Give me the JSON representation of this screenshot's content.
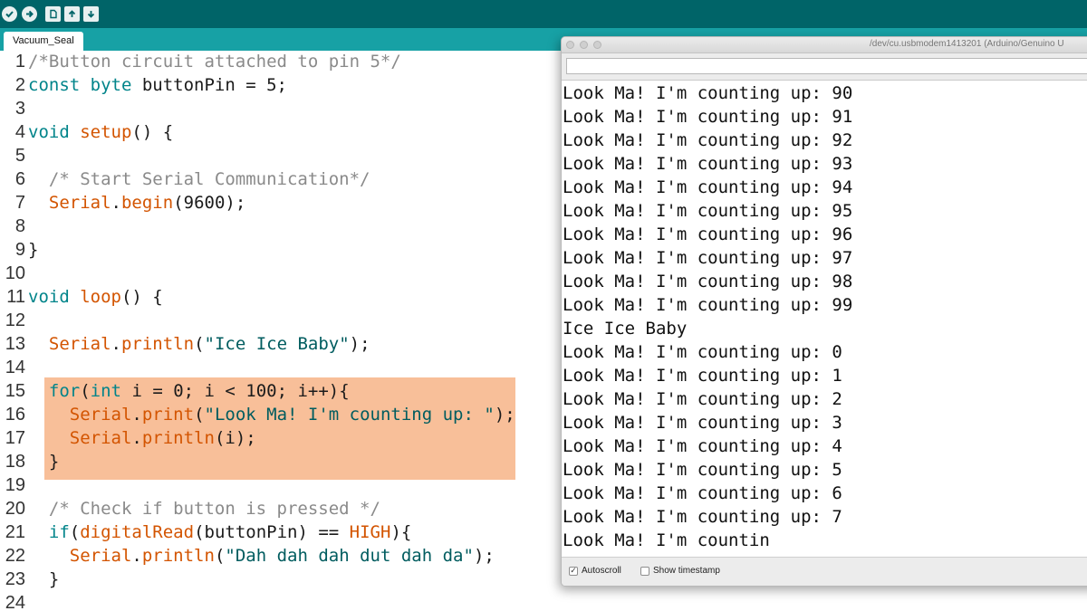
{
  "editor": {
    "tab_label": "Vacuum_Seal",
    "lines": [
      {
        "n": "1",
        "parts": [
          {
            "t": "/*Button circuit attached to pin 5*/",
            "c": "comment"
          }
        ]
      },
      {
        "n": "2",
        "parts": [
          {
            "t": "const byte ",
            "c": "kw"
          },
          {
            "t": "buttonPin = 5;",
            "c": ""
          }
        ]
      },
      {
        "n": "3",
        "parts": []
      },
      {
        "n": "4",
        "parts": [
          {
            "t": "void ",
            "c": "kw"
          },
          {
            "t": "setup",
            "c": "fn"
          },
          {
            "t": "() {",
            "c": ""
          }
        ]
      },
      {
        "n": "5",
        "parts": []
      },
      {
        "n": "6",
        "parts": [
          {
            "t": "  /* Start Serial Communication*/",
            "c": "comment"
          }
        ]
      },
      {
        "n": "7",
        "parts": [
          {
            "t": "  ",
            "c": ""
          },
          {
            "t": "Serial",
            "c": "fn"
          },
          {
            "t": ".",
            "c": ""
          },
          {
            "t": "begin",
            "c": "fn"
          },
          {
            "t": "(9600);",
            "c": ""
          }
        ]
      },
      {
        "n": "8",
        "parts": []
      },
      {
        "n": "9",
        "parts": [
          {
            "t": "}",
            "c": ""
          }
        ]
      },
      {
        "n": "10",
        "parts": []
      },
      {
        "n": "11",
        "parts": [
          {
            "t": "void ",
            "c": "kw"
          },
          {
            "t": "loop",
            "c": "fn"
          },
          {
            "t": "() {",
            "c": ""
          }
        ]
      },
      {
        "n": "12",
        "parts": []
      },
      {
        "n": "13",
        "parts": [
          {
            "t": "  ",
            "c": ""
          },
          {
            "t": "Serial",
            "c": "fn"
          },
          {
            "t": ".",
            "c": ""
          },
          {
            "t": "println",
            "c": "fn"
          },
          {
            "t": "(",
            "c": ""
          },
          {
            "t": "\"Ice Ice Baby\"",
            "c": "str"
          },
          {
            "t": ");",
            "c": ""
          }
        ]
      },
      {
        "n": "14",
        "parts": []
      },
      {
        "n": "15",
        "parts": [
          {
            "t": "  ",
            "c": ""
          },
          {
            "t": "for",
            "c": "kw"
          },
          {
            "t": "(",
            "c": ""
          },
          {
            "t": "int",
            "c": "kw"
          },
          {
            "t": " i = 0; i < 100; i++){",
            "c": ""
          }
        ]
      },
      {
        "n": "16",
        "parts": [
          {
            "t": "    ",
            "c": ""
          },
          {
            "t": "Serial",
            "c": "fn"
          },
          {
            "t": ".",
            "c": ""
          },
          {
            "t": "print",
            "c": "fn"
          },
          {
            "t": "(",
            "c": ""
          },
          {
            "t": "\"Look Ma! I'm counting up: \"",
            "c": "str"
          },
          {
            "t": ");",
            "c": ""
          }
        ]
      },
      {
        "n": "17",
        "parts": [
          {
            "t": "    ",
            "c": ""
          },
          {
            "t": "Serial",
            "c": "fn"
          },
          {
            "t": ".",
            "c": ""
          },
          {
            "t": "println",
            "c": "fn"
          },
          {
            "t": "(i);",
            "c": ""
          }
        ]
      },
      {
        "n": "18",
        "parts": [
          {
            "t": "  }",
            "c": ""
          }
        ]
      },
      {
        "n": "19",
        "parts": []
      },
      {
        "n": "20",
        "parts": [
          {
            "t": "  /* Check if button is pressed */",
            "c": "comment"
          }
        ]
      },
      {
        "n": "21",
        "parts": [
          {
            "t": "  ",
            "c": ""
          },
          {
            "t": "if",
            "c": "kw"
          },
          {
            "t": "(",
            "c": ""
          },
          {
            "t": "digitalRead",
            "c": "fn"
          },
          {
            "t": "(buttonPin) == ",
            "c": ""
          },
          {
            "t": "HIGH",
            "c": "fn"
          },
          {
            "t": "){",
            "c": ""
          }
        ]
      },
      {
        "n": "22",
        "parts": [
          {
            "t": "    ",
            "c": ""
          },
          {
            "t": "Serial",
            "c": "fn"
          },
          {
            "t": ".",
            "c": ""
          },
          {
            "t": "println",
            "c": "fn"
          },
          {
            "t": "(",
            "c": ""
          },
          {
            "t": "\"Dah dah dah dut dah da\"",
            "c": "str"
          },
          {
            "t": ");",
            "c": ""
          }
        ]
      },
      {
        "n": "23",
        "parts": [
          {
            "t": "  }",
            "c": ""
          }
        ]
      },
      {
        "n": "24",
        "parts": []
      }
    ]
  },
  "monitor": {
    "title": "/dev/cu.usbmodem1413201 (Arduino/Genuino U",
    "output_lines": [
      "Look Ma! I'm counting up: 90",
      "Look Ma! I'm counting up: 91",
      "Look Ma! I'm counting up: 92",
      "Look Ma! I'm counting up: 93",
      "Look Ma! I'm counting up: 94",
      "Look Ma! I'm counting up: 95",
      "Look Ma! I'm counting up: 96",
      "Look Ma! I'm counting up: 97",
      "Look Ma! I'm counting up: 98",
      "Look Ma! I'm counting up: 99",
      "Ice Ice Baby",
      "Look Ma! I'm counting up: 0",
      "Look Ma! I'm counting up: 1",
      "Look Ma! I'm counting up: 2",
      "Look Ma! I'm counting up: 3",
      "Look Ma! I'm counting up: 4",
      "Look Ma! I'm counting up: 5",
      "Look Ma! I'm counting up: 6",
      "Look Ma! I'm counting up: 7",
      "Look Ma! I'm countin"
    ],
    "autoscroll_label": "Autoscroll",
    "autoscroll_checked": true,
    "timestamp_label": "Show timestamp",
    "timestamp_checked": false
  },
  "toolbar": {
    "buttons": [
      "verify-icon",
      "upload-icon",
      "new-icon",
      "open-icon",
      "save-icon"
    ]
  },
  "colors": {
    "toolbar": "#006468",
    "tabbar": "#17a1a5",
    "highlight": "#f8bf99",
    "keyword": "#00848a",
    "function": "#d35400",
    "comment": "#8a8a8a"
  }
}
